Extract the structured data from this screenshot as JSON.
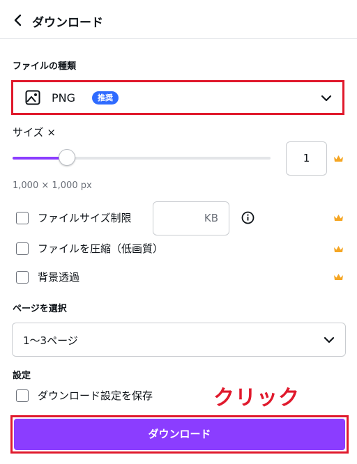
{
  "header": {
    "back_icon": "chevron-left-icon",
    "title": "ダウンロード"
  },
  "file_type": {
    "label": "ファイルの種類",
    "selected": "PNG",
    "badge": "推奨",
    "icon": "image-icon"
  },
  "size": {
    "label": "サイズ ×",
    "value": "1",
    "slider_fraction": 0.21,
    "dimensions": "1,000 × 1,000 px"
  },
  "options": [
    {
      "label": "ファイルサイズ制限",
      "checked": false
    },
    {
      "label": "ファイルを圧縮（低画質）",
      "checked": false
    },
    {
      "label": "背景透過",
      "checked": false
    }
  ],
  "filesize_limit": {
    "unit": "KB",
    "value": ""
  },
  "pages": {
    "label": "ページを選択",
    "selected": "1〜3ページ"
  },
  "settings": {
    "label": "設定",
    "save_label": "ダウンロード設定を保存",
    "checked": false
  },
  "annotation": "クリック",
  "download_button": "ダウンロード",
  "colors": {
    "accent": "#8b3dff",
    "highlight": "#e0192c",
    "badge": "#2f6bff",
    "crown": "#f5a623"
  }
}
